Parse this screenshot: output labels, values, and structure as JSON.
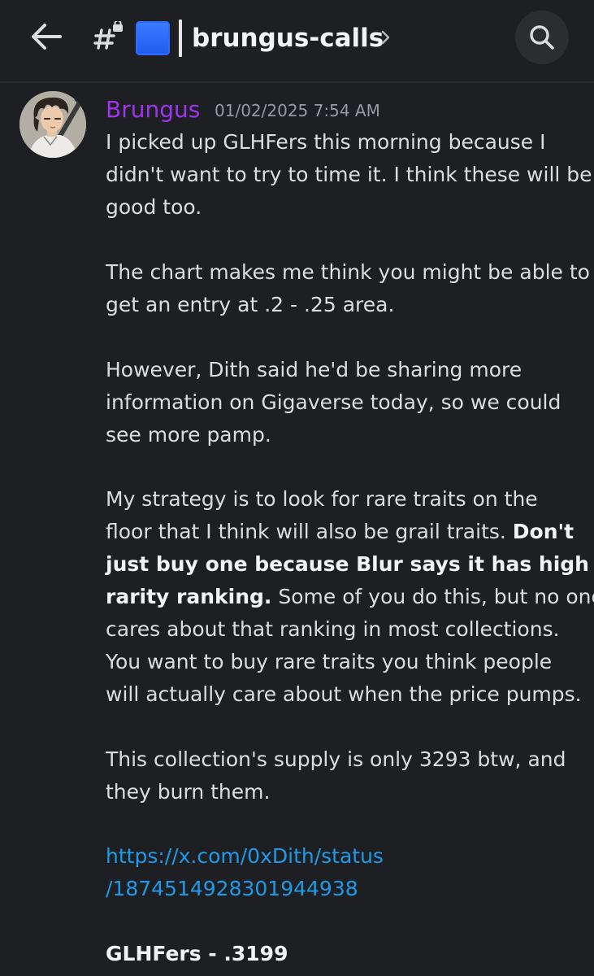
{
  "header": {
    "back_icon": "arrow-left-icon",
    "channel_icon": "text-channel-locked-icon",
    "channel_emoji": "blue-square",
    "channel_name": "brungus-calls",
    "chevron_icon": "chevron-right-icon",
    "search_icon": "search-icon"
  },
  "message": {
    "author": "Brungus",
    "author_color": "#a033f0",
    "timestamp": "01/02/2025 7:54 AM",
    "p1": [
      "I picked up GLHFers this morning because I",
      "didn't want to try to time it. I think these will be",
      "good too."
    ],
    "p2": [
      "The chart makes me think you might be able to",
      "get an entry at .2 - .25 area."
    ],
    "p3": [
      "However, Dith said he'd be sharing more",
      "information on Gigaverse today, so we could",
      "see more pamp."
    ],
    "p4": {
      "l1": "My strategy is to look for rare  traits on the",
      "l2a": "floor that I think will also be grail traits. ",
      "l2b": "Don't",
      "l3": "just buy one because Blur says it has high",
      "l4a": "rarity ranking.",
      "l4b": " Some of you do this, but no one",
      "l5": "cares about that ranking in most collections.",
      "l6": "You want to buy rare traits you think people",
      "l7": "will actually care about when the price pumps."
    },
    "p5": [
      "This collection's supply is only 3293 btw, and",
      "they burn them."
    ],
    "link": [
      "https://x.com/0xDith/status",
      "/1874514928301944938"
    ],
    "final": "GLHFers - .3199"
  }
}
